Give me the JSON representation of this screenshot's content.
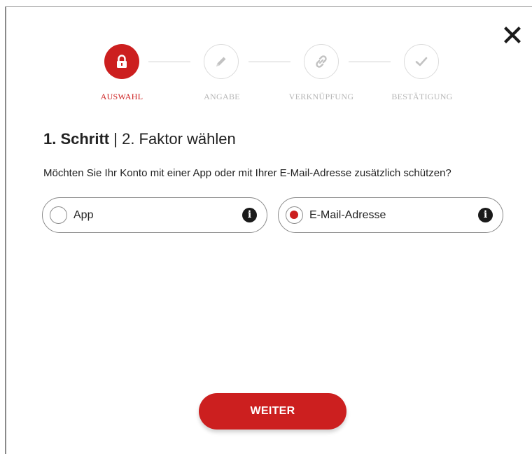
{
  "stepper": {
    "steps": [
      {
        "label": "AUSWAHL",
        "icon": "lock-icon",
        "state": "active"
      },
      {
        "label": "ANGABE",
        "icon": "pencil-icon",
        "state": "inactive"
      },
      {
        "label": "VERKNÜPFUNG",
        "icon": "link-icon",
        "state": "inactive"
      },
      {
        "label": "BESTÄTIGUNG",
        "icon": "check-icon",
        "state": "inactive"
      }
    ]
  },
  "heading": {
    "step": "1. Schritt",
    "separator": " | ",
    "title": "2. Faktor wählen"
  },
  "question": "Möchten Sie Ihr Konto mit einer App oder mit Ihrer E-Mail-Adresse zusätzlich schützen?",
  "options": [
    {
      "label": "App",
      "selected": false
    },
    {
      "label": "E-Mail-Adresse",
      "selected": true
    }
  ],
  "info_glyph": "i",
  "actions": {
    "continue_label": "WEITER"
  },
  "colors": {
    "accent": "#cc1f1f",
    "inactive": "#b6b6b6"
  }
}
